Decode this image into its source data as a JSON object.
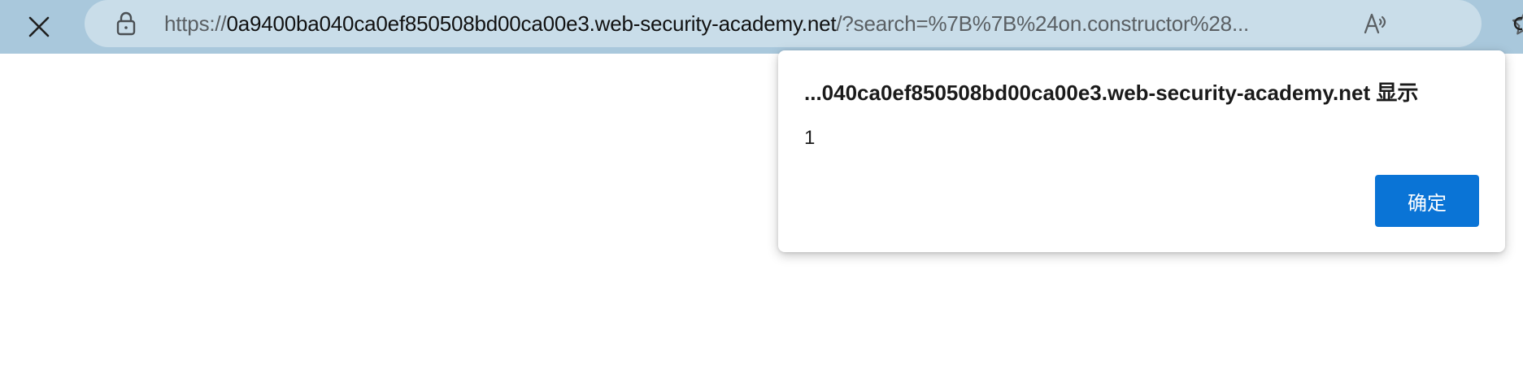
{
  "browser": {
    "close_icon": "close-icon",
    "lock_icon": "lock-icon",
    "read_aloud_icon": "read-aloud-icon",
    "favorite_icon": "star-icon",
    "address": {
      "scheme": "https://",
      "host": "0a9400ba040ca0ef850508bd00ca00e3.web-security-academy.net",
      "rest": "/?search=%7B%7B%24on.constructor%28..."
    }
  },
  "dialog": {
    "title": "...040ca0ef850508bd00ca00e3.web-security-academy.net 显示",
    "message": "1",
    "ok_label": "确定"
  },
  "colors": {
    "toolbar": "#a9c8dc",
    "addressbar": "#c9dde9",
    "primary_button": "#0a74d6"
  }
}
